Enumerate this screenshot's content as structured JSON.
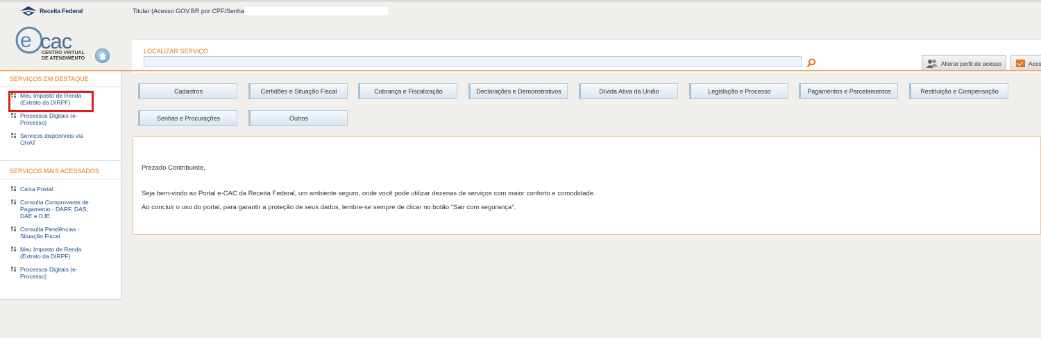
{
  "header": {
    "rf_logo_text": "Receita Federal",
    "ecac_letters": "cac",
    "ecac_subtitle_line1": "CENTRO VIRTUAL",
    "ecac_subtitle_line2": "DE ATENDIMENTO",
    "titular_label": "Titular (Acesso GOV.BR por CPF/Senha)",
    "search_label": "LOCALIZAR SERVIÇO",
    "search_value": "",
    "profile_button": "Alterar perfil de acesso",
    "message_button": "Acesso"
  },
  "sidebar": {
    "highlight_title": "SERVIÇOS EM DESTAQUE",
    "highlight_items": [
      {
        "label": "Meu Imposto de Renda (Extrato da DIRPF)"
      },
      {
        "label": "Processos Digitais (e-Processo)"
      },
      {
        "label": "Serviços disponíveis via CHAT"
      }
    ],
    "most_title": "SERVIÇOS MAIS ACESSADOS",
    "most_items": [
      {
        "label": "Caixa Postal"
      },
      {
        "label": "Consulta Comprovante de Pagamento - DARF, DAS, DAE e DJE"
      },
      {
        "label": "Consulta Pendências - Situação Fiscal"
      },
      {
        "label": "Meu Imposto de Renda (Extrato da DIRPF)"
      },
      {
        "label": "Processos Digitais (e-Processo)"
      }
    ]
  },
  "categories": [
    "Cadastros",
    "Certidões e Situação Fiscal",
    "Cobrança e Fiscalização",
    "Declarações e Demonstrativos",
    "Dívida Ativa da União",
    "Legislação e Processo",
    "Pagamentos e Parcelamentos",
    "Restituição e Compensação",
    "Senhas e Procurações",
    "Outros"
  ],
  "welcome": {
    "greeting": "Prezado Contribuinte,",
    "line1": "Seja bem-vindo ao Portal e-CAC da Receita Federal, um ambiente seguro, onde você pode utilizar dezenas de serviços com maior conforto e comodidade.",
    "line2": "Ao concluir o uso do portal, para garantir a proteção de seus dados, lembre-se sempre de clicar no botão “Sair com segurança”."
  },
  "colors": {
    "accent_orange": "#e3731f",
    "link_blue": "#1a4a8a",
    "highlight_red": "#e01b1b"
  }
}
